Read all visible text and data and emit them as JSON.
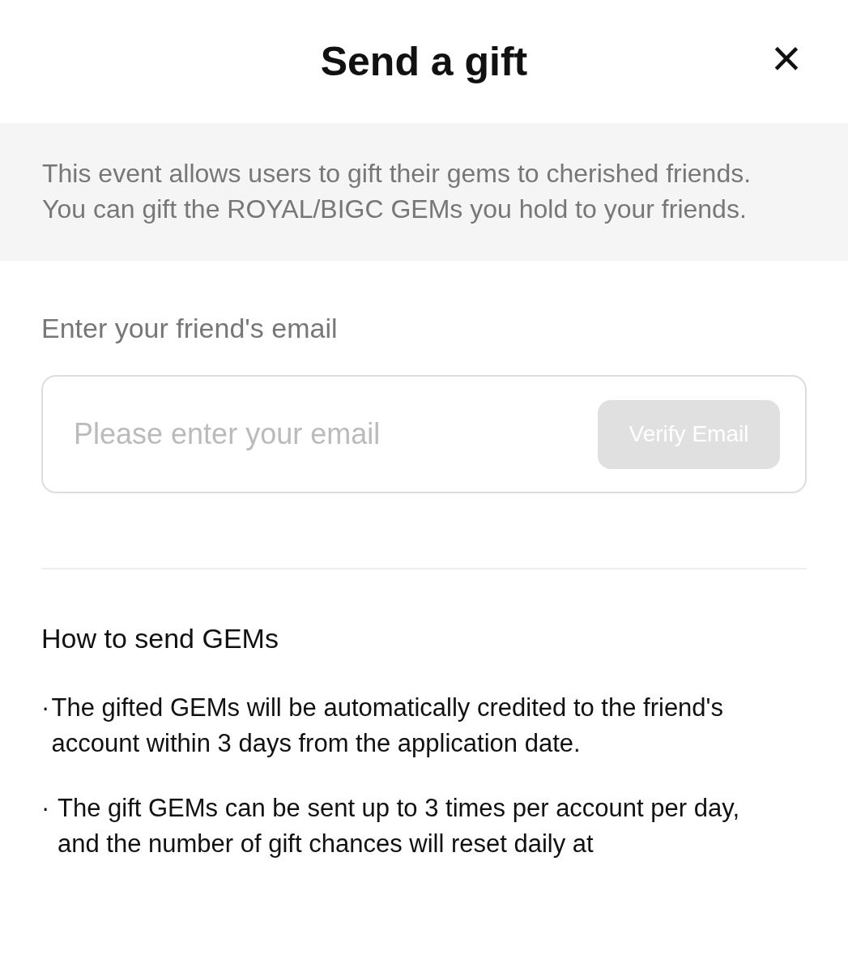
{
  "header": {
    "title": "Send a gift",
    "close_icon": "×"
  },
  "notice": {
    "lines": [
      "This event allows users to gift their gems to cherished friends.",
      "You can gift the ROYAL/BIGC GEMs you hold to your friends."
    ]
  },
  "email_form": {
    "label": "Enter your friend's email",
    "placeholder": "Please enter your email",
    "button": {
      "label": "Verify Email",
      "disabled": true
    }
  },
  "instructions": {
    "heading": "How to send GEMs",
    "items": [
      {
        "marker": "·",
        "text": "The gifted GEMs will be automatically credited to the friend's account within 3 days from the application date."
      },
      {
        "marker": "·",
        "text": "The gift GEMs can be sent up to 3 times per account per day,\nand the number of gift chances will reset daily at"
      }
    ]
  }
}
